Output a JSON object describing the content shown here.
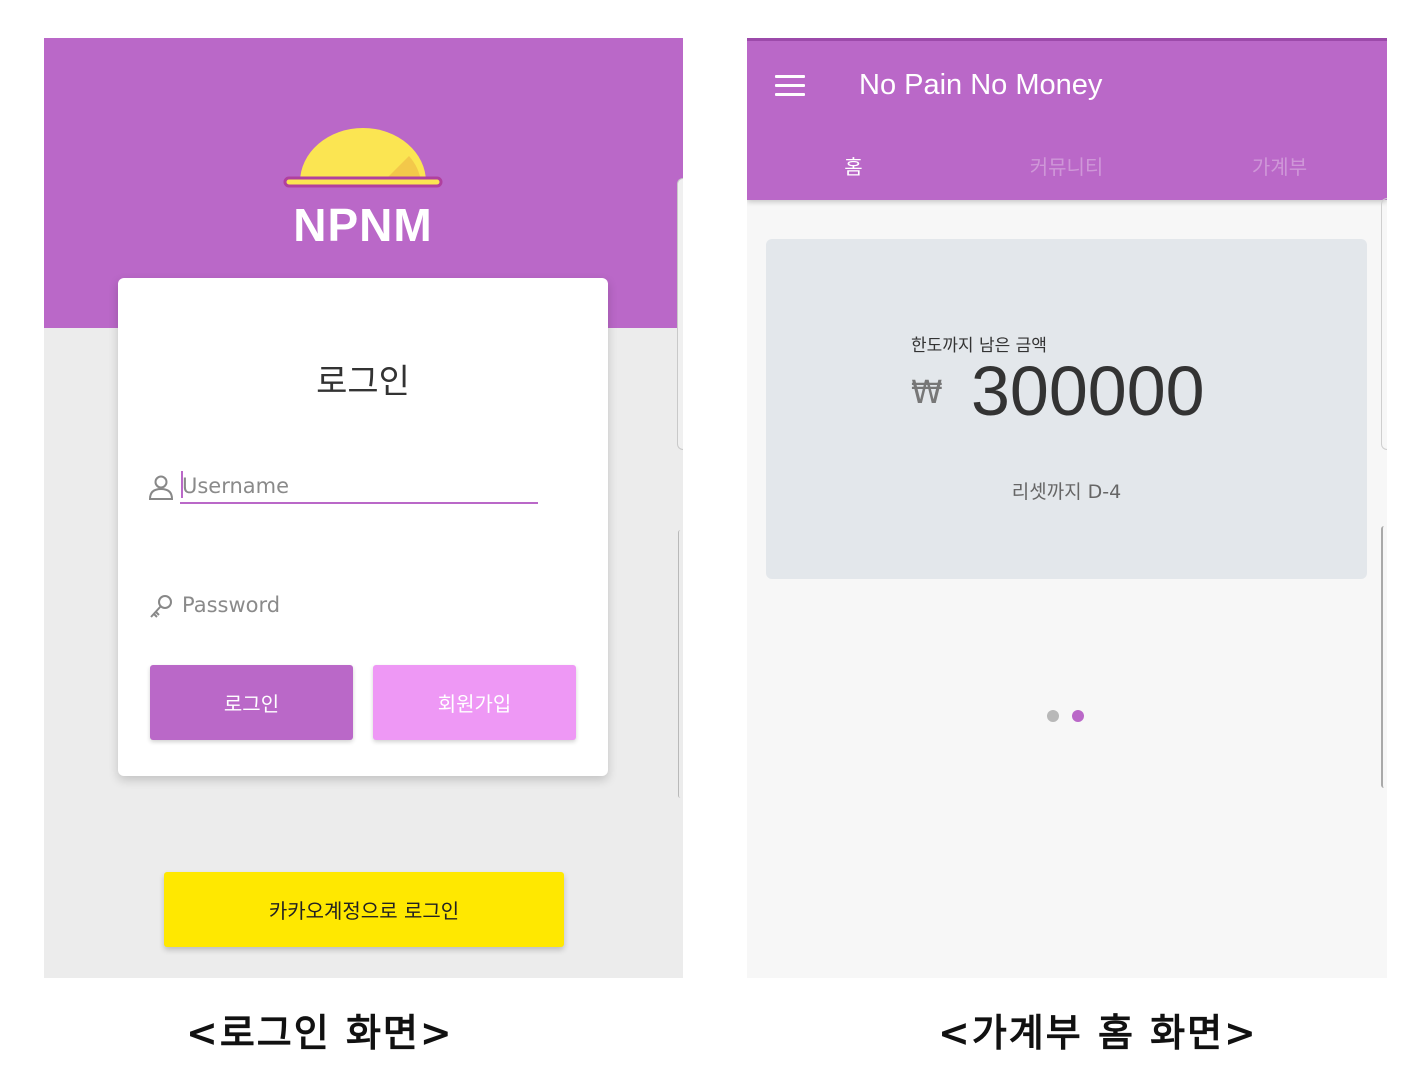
{
  "login_screen": {
    "logo_text": "NPNM",
    "title": "로그인",
    "username": {
      "value": "",
      "placeholder": "Username"
    },
    "password": {
      "value": "",
      "placeholder": "Password"
    },
    "login_button": "로그인",
    "signup_button": "회원가입",
    "kakao_button": "카카오계정으로 로그인",
    "colors": {
      "brand": "#ba68c8",
      "signup": "#ee98f5",
      "kakao": "#ffe800",
      "sun": "#fbe552"
    }
  },
  "home_screen": {
    "menu_icon": "hamburger-menu-icon",
    "app_title": "No Pain No Money",
    "tabs": [
      {
        "label": "홈",
        "active": true
      },
      {
        "label": "커뮤니티",
        "active": false
      },
      {
        "label": "가계부",
        "active": false
      }
    ],
    "balance": {
      "label": "한도까지 남은 금액",
      "currency": "₩",
      "amount": "300000",
      "reset": "리셋까지 D-4"
    },
    "pager": {
      "pages": 2,
      "active": 2
    }
  },
  "captions": {
    "left": "<로그인 화면>",
    "right": "<가계부 홈 화면>"
  }
}
